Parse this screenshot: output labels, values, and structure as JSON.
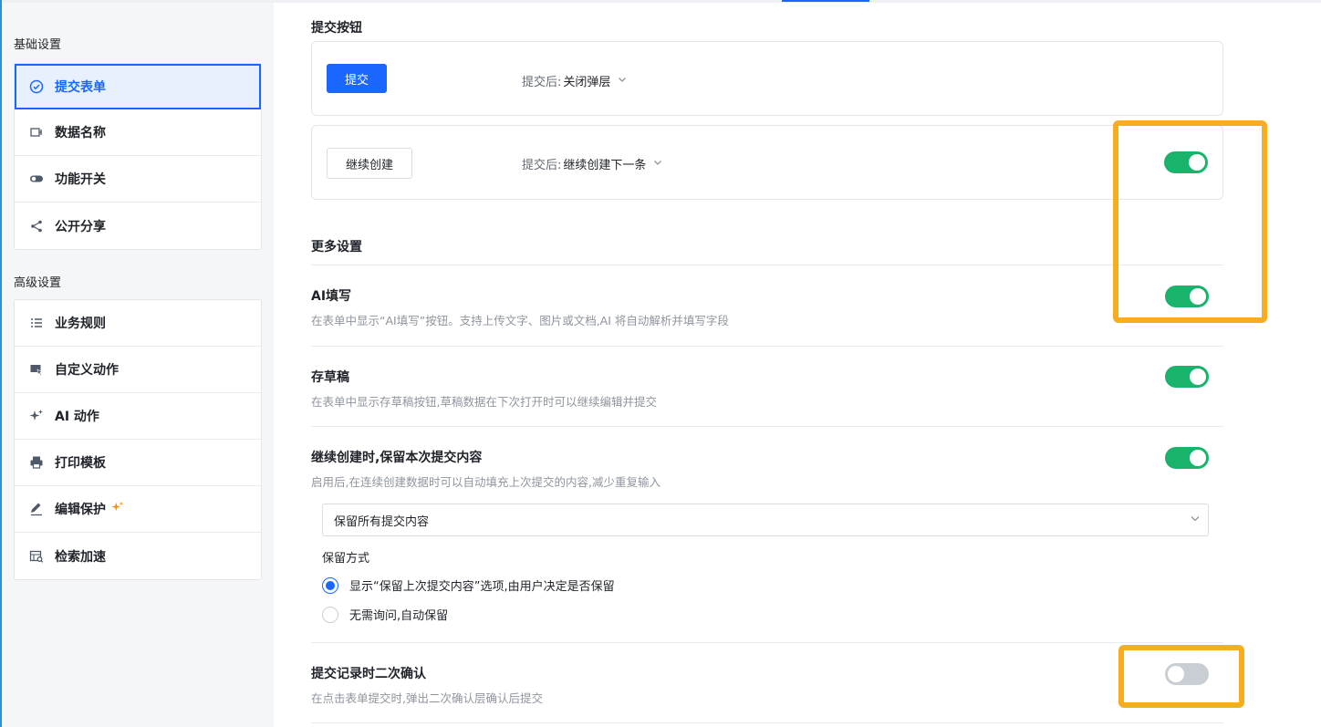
{
  "sidebar": {
    "basic_title": "基础设置",
    "basic_items": [
      {
        "label": "提交表单",
        "icon": "check-circle-icon"
      },
      {
        "label": "数据名称",
        "icon": "data-label-icon"
      },
      {
        "label": "功能开关",
        "icon": "toggle-icon"
      },
      {
        "label": "公开分享",
        "icon": "share-icon"
      }
    ],
    "advanced_title": "高级设置",
    "advanced_items": [
      {
        "label": "业务规则",
        "icon": "list-icon"
      },
      {
        "label": "自定义动作",
        "icon": "custom-action-icon"
      },
      {
        "label": "AI 动作",
        "icon": "sparkle-icon"
      },
      {
        "label": "打印模板",
        "icon": "printer-icon"
      },
      {
        "label": "编辑保护",
        "icon": "pen-icon"
      },
      {
        "label": "检索加速",
        "icon": "search-speed-icon"
      }
    ]
  },
  "submit_section": {
    "title": "提交按钮",
    "submit_button": {
      "label": "提交",
      "after_prefix": "提交后:",
      "after_value": "关闭弹层"
    },
    "continue_button": {
      "label": "继续创建",
      "after_prefix": "提交后:",
      "after_value": "继续创建下一条",
      "enabled": true
    }
  },
  "more_section": {
    "title": "更多设置",
    "settings": [
      {
        "title": "AI填写",
        "desc": "在表单中显示“AI填写”按钮。支持上传文字、图片或文档,AI 将自动解析并填写字段",
        "enabled": true
      },
      {
        "title": "存草稿",
        "desc": "在表单中显示存草稿按钮,草稿数据在下次打开时可以继续编辑并提交",
        "enabled": true
      },
      {
        "title": "继续创建时,保留本次提交内容",
        "desc": "启用后,在连续创建数据时可以自动填充上次提交的内容,减少重复输入",
        "enabled": true
      },
      {
        "title": "提交记录时二次确认",
        "desc": "在点击表单提交时,弹出二次确认层确认后提交",
        "enabled": false
      }
    ],
    "retain_select": "保留所有提交内容",
    "retain_mode_label": "保留方式",
    "retain_options": [
      {
        "label": "显示“保留上次提交内容”选项,由用户决定是否保留",
        "checked": true
      },
      {
        "label": "无需询问,自动保留",
        "checked": false
      }
    ]
  },
  "colors": {
    "accent": "#1a66ff",
    "toggle_on": "#19b36b",
    "highlight": "#f8ad20"
  }
}
